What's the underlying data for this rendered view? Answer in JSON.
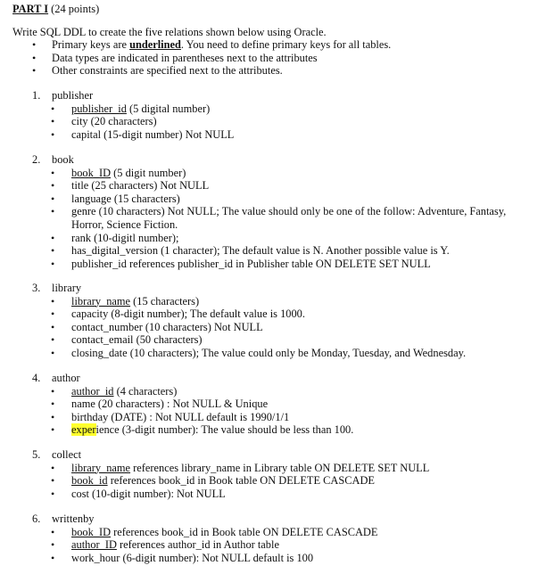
{
  "header": {
    "part_label": "PART I",
    "points": " (24 points)"
  },
  "intro": {
    "text": "Write SQL DDL to create the five relations shown below using Oracle.",
    "bullets": [
      {
        "pre": "Primary keys are ",
        "bold": "underlined",
        "post": ". You need to define primary keys for all tables."
      },
      {
        "pre": "Data types are indicated in parentheses next to the attributes",
        "bold": "",
        "post": ""
      },
      {
        "pre": "Other constraints are specified next to the attributes.",
        "bold": "",
        "post": ""
      }
    ],
    "bullet_glyph": "•"
  },
  "sections": [
    {
      "number": "1.",
      "name": "publisher",
      "attributes": [
        {
          "key": "publisher_id",
          "rest": " (5 digital number)"
        },
        {
          "key": "",
          "rest": "city (20 characters)"
        },
        {
          "key": "",
          "rest": "capital (15-digit number) Not NULL"
        }
      ]
    },
    {
      "number": "2.",
      "name": "book",
      "attributes": [
        {
          "key": "book_ID",
          "rest": " (5 digit number)"
        },
        {
          "key": "",
          "rest": "title (25 characters) Not NULL"
        },
        {
          "key": "",
          "rest": "language (15 characters)"
        },
        {
          "key": "",
          "rest": "genre (10 characters) Not NULL; The value should only be one of the follow: Adventure, Fantasy, Horror, Science Fiction."
        },
        {
          "key": "",
          "rest": "rank (10-digitl number);"
        },
        {
          "key": "",
          "rest": "has_digital_version (1 character); The default value is N. Another possible value is Y."
        },
        {
          "key": "",
          "rest": "publisher_id references publisher_id in Publisher table ON DELETE SET NULL"
        }
      ]
    },
    {
      "number": "3.",
      "name": "library",
      "attributes": [
        {
          "key": "library_name",
          "rest": " (15 characters)"
        },
        {
          "key": "",
          "rest": "capacity (8-digit number); The default value is 1000."
        },
        {
          "key": "",
          "rest": "contact_number (10 characters) Not NULL"
        },
        {
          "key": "",
          "rest": "contact_email (50 characters)"
        },
        {
          "key": "",
          "rest": "closing_date (10 characters); The value could only be Monday, Tuesday, and Wednesday."
        }
      ]
    },
    {
      "number": "4.",
      "name": "author",
      "attributes": [
        {
          "key": "author_id",
          "rest": " (4 characters)"
        },
        {
          "key": "",
          "rest": "name (20 characters) : Not NULL & Unique"
        },
        {
          "key": "",
          "rest": "birthday (DATE) : Not NULL default is 1990/1/1"
        },
        {
          "key": "",
          "highlight": "exper",
          "rest": "ience (3-digit number): The value should be less than 100."
        }
      ]
    },
    {
      "number": "5.",
      "name": "collect",
      "attributes": [
        {
          "key": "library_name",
          "rest": " references library_name in Library table ON DELETE SET NULL"
        },
        {
          "key": "book_id",
          "rest": " references book_id in Book table ON DELETE CASCADE"
        },
        {
          "key": "",
          "rest": "cost (10-digit number): Not NULL"
        }
      ]
    },
    {
      "number": "6.",
      "name": "writtenby",
      "attributes": [
        {
          "key": "book_ID",
          "rest": " references book_id in Book table ON DELETE CASCADE"
        },
        {
          "key": "author_ID",
          "rest": " references author_id in Author table"
        },
        {
          "key": "",
          "rest": "work_hour (6-digit number): Not NULL default is 100"
        }
      ]
    }
  ],
  "colors": {
    "text": "#111111",
    "highlight": "#ffff2e",
    "background": "#ffffff"
  }
}
